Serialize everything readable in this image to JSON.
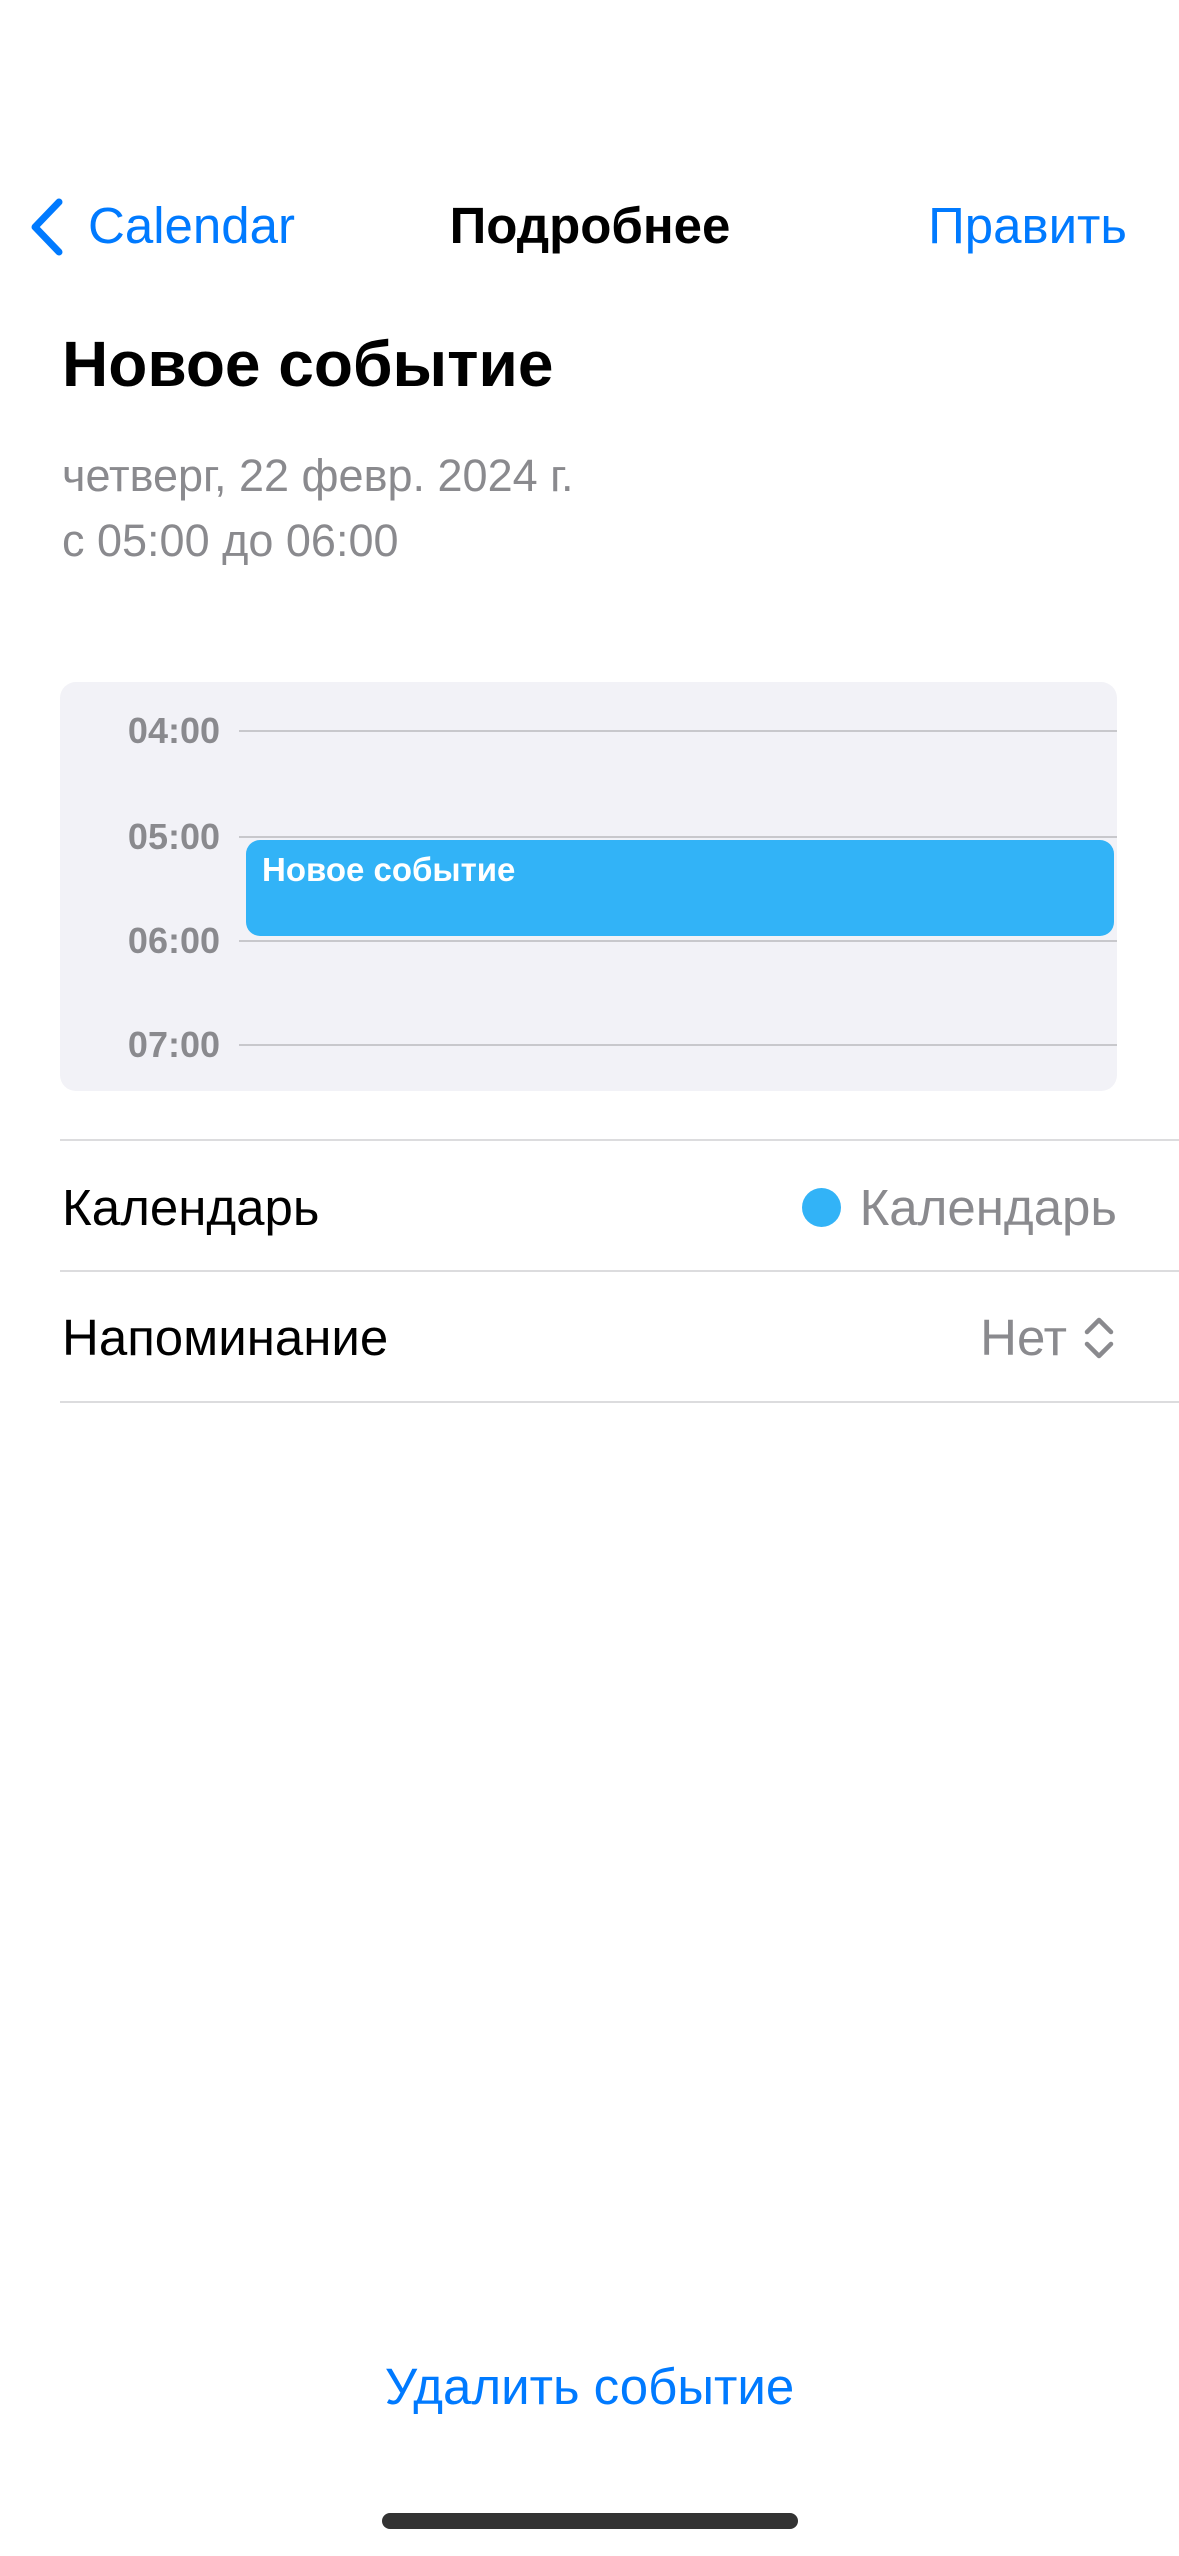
{
  "nav": {
    "back_icon": "chevron-left-icon",
    "back_label": "Calendar",
    "title": "Подробнее",
    "edit_label": "Править"
  },
  "event": {
    "title": "Новое событие",
    "date": "четверг, 22 февр. 2024 г.",
    "time": "с 05:00 до 06:00"
  },
  "timeline": {
    "hours": [
      "04:00",
      "05:00",
      "06:00",
      "07:00"
    ]
  },
  "details": {
    "calendar": {
      "label": "Календарь",
      "value": "Календарь",
      "icon": "calendar-color-dot-icon"
    },
    "alert": {
      "label": "Напоминание",
      "value": "Нет",
      "icon": "up-down-chevron-icon"
    }
  },
  "delete_label": "Удалить событие",
  "colors": {
    "accent": "#007aff",
    "secondary_text": "#8a8a8e",
    "timeline_background": "#f2f2f7",
    "event": "#32b3f7"
  }
}
